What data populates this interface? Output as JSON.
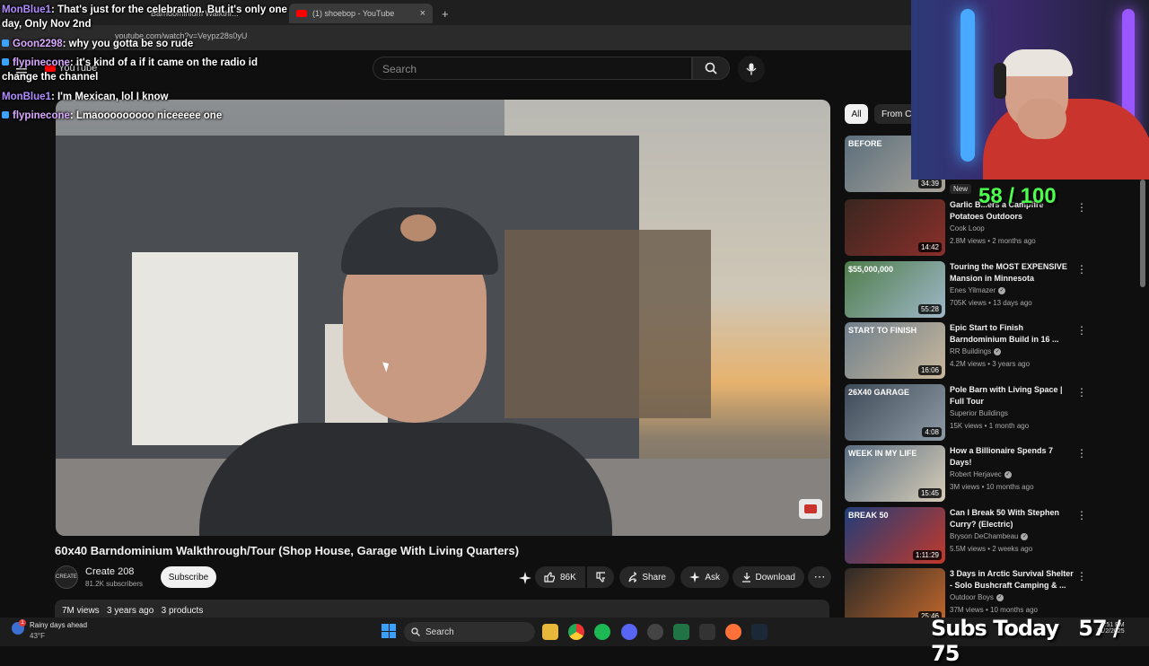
{
  "browser": {
    "tabs": [
      {
        "label": "Barndominium Walkthr..."
      },
      {
        "label": "(1) shoebop - YouTube"
      }
    ],
    "new_tab": "+",
    "close": "×",
    "url": "youtube.com/watch?v=Veypz28s0yU"
  },
  "youtube": {
    "logo": "YouTube",
    "search_placeholder": "Search"
  },
  "video": {
    "title": "60x40 Barndominium Walkthrough/Tour (Shop House, Garage With Living Quarters)",
    "channel": "Create 208",
    "channel_avatar_text": "CREATE",
    "subscribers": "81.2K subscribers",
    "subscribe_label": "Subscribe",
    "likes": "86K",
    "share": "Share",
    "ask": "Ask",
    "download": "Download",
    "views": "7M views",
    "age": "3 years ago",
    "products": "3 products"
  },
  "sidebar": {
    "chips": [
      "All",
      "From Cr"
    ],
    "new_badge": "New",
    "recommendations": [
      {
        "title": "",
        "channel": "",
        "meta": "",
        "duration": "34:39",
        "thumb_text": "BEFORE",
        "colors": [
          "#5b6e7c",
          "#a9a49a"
        ]
      },
      {
        "title": "Garlic B...ers a Campfire Potatoes Outdoors",
        "channel": "Cook Loop",
        "meta": "2.8M views • 2 months ago",
        "duration": "14:42",
        "thumb_text": "",
        "colors": [
          "#3a2620",
          "#8a2f2a"
        ]
      },
      {
        "title": "Touring the MOST EXPENSIVE Mansion in Minnesota",
        "channel": "Enes Yilmazer",
        "meta": "705K views • 13 days ago",
        "duration": "55:28",
        "thumb_text": "$55,000,000",
        "colors": [
          "#4e7d4a",
          "#9fb6c8"
        ]
      },
      {
        "title": "Epic Start to Finish Barndominium Build in 16 ...",
        "channel": "RR Buildings",
        "meta": "4.2M views • 3 years ago",
        "duration": "16:06",
        "thumb_text": "START TO FINISH",
        "colors": [
          "#6f7f8c",
          "#c9b89c"
        ]
      },
      {
        "title": "Pole Barn with Living Space | Full Tour",
        "channel": "Superior Buildings",
        "meta": "15K views • 1 month ago",
        "duration": "4:08",
        "thumb_text": "26X40 GARAGE",
        "colors": [
          "#3e4a57",
          "#8e9ba6"
        ]
      },
      {
        "title": "How a Billionaire Spends 7 Days!",
        "channel": "Robert Herjavec",
        "meta": "3M views • 10 months ago",
        "duration": "15:45",
        "thumb_text": "WEEK IN MY LIFE",
        "colors": [
          "#5a6d80",
          "#d7cdb8"
        ]
      },
      {
        "title": "Can I Break 50 With Stephen Curry? (Electric)",
        "channel": "Bryson DeChambeau",
        "meta": "5.5M views • 2 weeks ago",
        "duration": "1:11:29",
        "thumb_text": "BREAK 50",
        "colors": [
          "#1f3d7a",
          "#c2392b"
        ]
      },
      {
        "title": "3 Days in Arctic Survival Shelter - Solo Bushcraft Camping & ...",
        "channel": "Outdoor Boys",
        "meta": "37M views • 10 months ago",
        "duration": "25:46",
        "thumb_text": "",
        "colors": [
          "#2d2a28",
          "#c2672a"
        ]
      }
    ]
  },
  "chat": [
    {
      "user": "MonBlue1",
      "text": ": That's just for the celebration. But it's only one day, Only Nov 2nd"
    },
    {
      "user": "Goon2298",
      "text": ": why you gotta be so rude"
    },
    {
      "user": "flypinecone",
      "text": ": it's kind of a if it came on the radio id change the channel"
    },
    {
      "user": "MonBlue1",
      "text": ": I'm Mexican, lol I know"
    },
    {
      "user": "flypinecone",
      "text": ": Lmaooooooooo niceeeee one"
    }
  ],
  "stream_overlay": {
    "goal": "58 / 100",
    "subs_today": "Subs Today",
    "subs_count": "57 / 75"
  },
  "taskbar": {
    "weather": "Rainy days ahead",
    "temp": "43°F",
    "weather_badge": "1",
    "search": "Search",
    "time": "9:51 PM",
    "date": "11/2/2025"
  }
}
